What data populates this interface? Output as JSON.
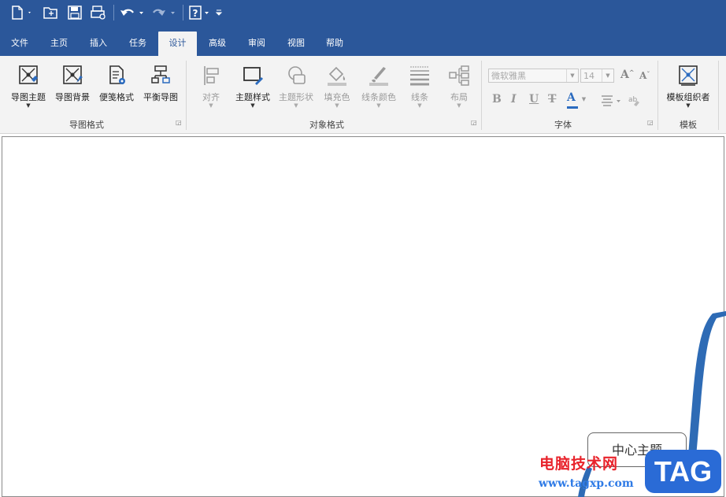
{
  "quick_access": {
    "icons": [
      "new-file-icon",
      "open-folder-icon",
      "save-icon",
      "print-preview-icon",
      "undo-icon",
      "redo-icon",
      "help-icon",
      "customize-icon"
    ]
  },
  "tabs": [
    {
      "label": "文件"
    },
    {
      "label": "主页"
    },
    {
      "label": "插入"
    },
    {
      "label": "任务"
    },
    {
      "label": "设计",
      "active": true
    },
    {
      "label": "高级"
    },
    {
      "label": "审阅"
    },
    {
      "label": "视图"
    },
    {
      "label": "帮助"
    }
  ],
  "ribbon": {
    "map_format": {
      "group_label": "导图格式",
      "buttons": [
        {
          "label": "导图主题",
          "icon": "map-theme-icon",
          "has_dropdown": true
        },
        {
          "label": "导图背景",
          "icon": "map-background-icon"
        },
        {
          "label": "便笺格式",
          "icon": "note-format-icon"
        },
        {
          "label": "平衡导图",
          "icon": "balance-map-icon"
        }
      ]
    },
    "object_format": {
      "group_label": "对象格式",
      "buttons": [
        {
          "label": "对齐",
          "enabled": false
        },
        {
          "label": "主题样式",
          "enabled": true
        },
        {
          "label": "主题形状",
          "enabled": false
        },
        {
          "label": "填充色",
          "enabled": false
        },
        {
          "label": "线条颜色",
          "enabled": false
        },
        {
          "label": "线条",
          "enabled": false
        },
        {
          "label": "布局",
          "enabled": false
        }
      ]
    },
    "font": {
      "group_label": "字体",
      "font_name": "微软雅黑",
      "font_size": "14",
      "glyphs": [
        "B",
        "I",
        "U",
        "T",
        "A"
      ]
    },
    "template": {
      "group_label": "模板",
      "buttons": [
        {
          "label": "模板组织者"
        }
      ]
    }
  },
  "canvas": {
    "central_topic": "中心主题"
  },
  "watermark": {
    "site_name": "电脑技术网",
    "url": "www.tagxp.com",
    "badge": "TAG"
  },
  "colors": {
    "title_bar": "#2b579a",
    "accent": "#2b579a",
    "branch": "#2e6bb5"
  }
}
